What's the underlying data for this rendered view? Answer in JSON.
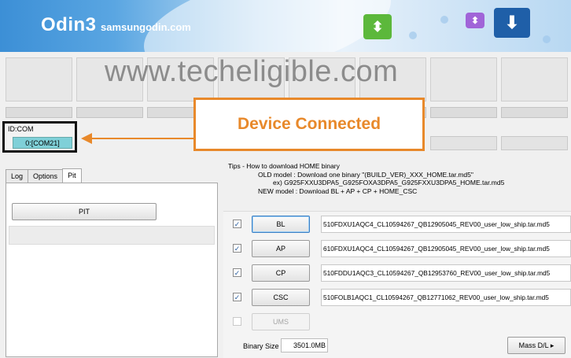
{
  "banner": {
    "title": "Odin3",
    "subtitle": "samsungodin.com",
    "icons": [
      "download-icon-green",
      "download-icon-purple",
      "download-icon-blue"
    ]
  },
  "watermark": "www.techeligible.com",
  "idcom": {
    "label": "ID:COM",
    "port": "0:[COM21]"
  },
  "callout": {
    "text": "Device Connected",
    "color": "#e8892b"
  },
  "tabs": [
    {
      "label": "Log"
    },
    {
      "label": "Options"
    },
    {
      "label": "Pit"
    }
  ],
  "pit": {
    "button_label": "PIT"
  },
  "tips": {
    "title": "Tips - How to download HOME binary",
    "line1": "OLD model  : Download one binary    \"(BUILD_VER)_XXX_HOME.tar.md5\"",
    "line2": "ex) G925FXXU3DPA5_G925FOXA3DPA5_G925FXXU3DPA5_HOME.tar.md5",
    "line3": "NEW model : Download BL + AP + CP + HOME_CSC"
  },
  "files": [
    {
      "label": "BL",
      "checked": true,
      "path": "510FDXU1AQC4_CL10594267_QB12905045_REV00_user_low_ship.tar.md5"
    },
    {
      "label": "AP",
      "checked": true,
      "path": "610FDXU1AQC4_CL10594267_QB12905045_REV00_user_low_ship.tar.md5"
    },
    {
      "label": "CP",
      "checked": true,
      "path": "510FDDU1AQC3_CL10594267_QB12953760_REV00_user_low_ship.tar.md5"
    },
    {
      "label": "CSC",
      "checked": true,
      "path": "510FOLB1AQC1_CL10594267_QB12771062_REV00_user_low_ship.tar.md5"
    },
    {
      "label": "UMS",
      "checked": false,
      "path": ""
    }
  ],
  "binary_size": {
    "label": "Binary Size",
    "value": "3501.0MB"
  },
  "mass_dl": {
    "label": "Mass D/L ▸"
  }
}
